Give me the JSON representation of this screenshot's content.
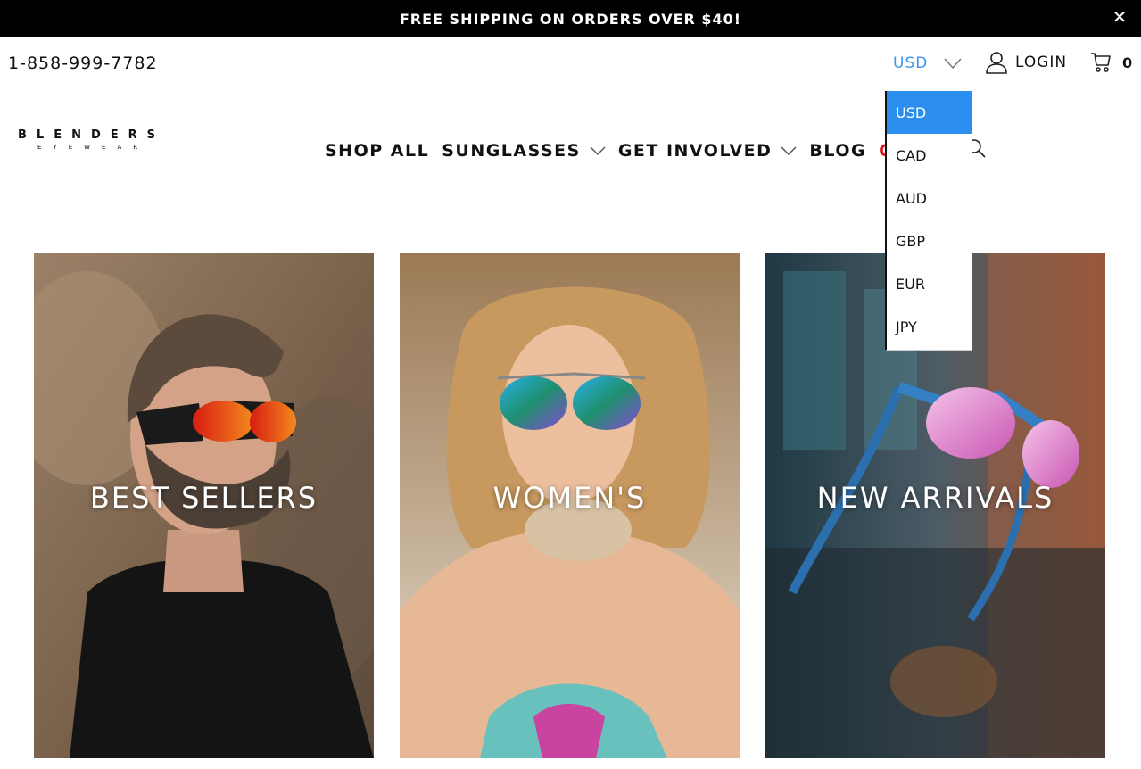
{
  "promo": {
    "text": "FREE SHIPPING ON ORDERS OVER $40!",
    "close_symbol": "✕"
  },
  "header": {
    "phone": "1-858-999-7782",
    "currency": {
      "selected": "USD",
      "options": [
        "USD",
        "CAD",
        "AUD",
        "GBP",
        "EUR",
        "JPY"
      ]
    },
    "login_label": "LOGIN",
    "cart_count": "0"
  },
  "logo": {
    "word": "BLENDERS",
    "sub": "EYEWEAR"
  },
  "nav": {
    "items": [
      {
        "label": "SHOP ALL"
      },
      {
        "label": "SUNGLASSES"
      },
      {
        "label": "GET INVOLVED"
      },
      {
        "label": "BLOG"
      },
      {
        "label": "GE"
      }
    ]
  },
  "collections": [
    {
      "label": "BEST SELLERS"
    },
    {
      "label": "WOMEN'S"
    },
    {
      "label": "NEW ARRIVALS"
    }
  ],
  "colors": {
    "accent": "#3c96e8",
    "selected_option": "#2c8ff0",
    "promo_bg": "#000000",
    "highlight_nav": "#e01b1b"
  },
  "icons": [
    "close-icon",
    "chevron-down-icon",
    "user-icon",
    "cart-icon",
    "search-icon"
  ]
}
